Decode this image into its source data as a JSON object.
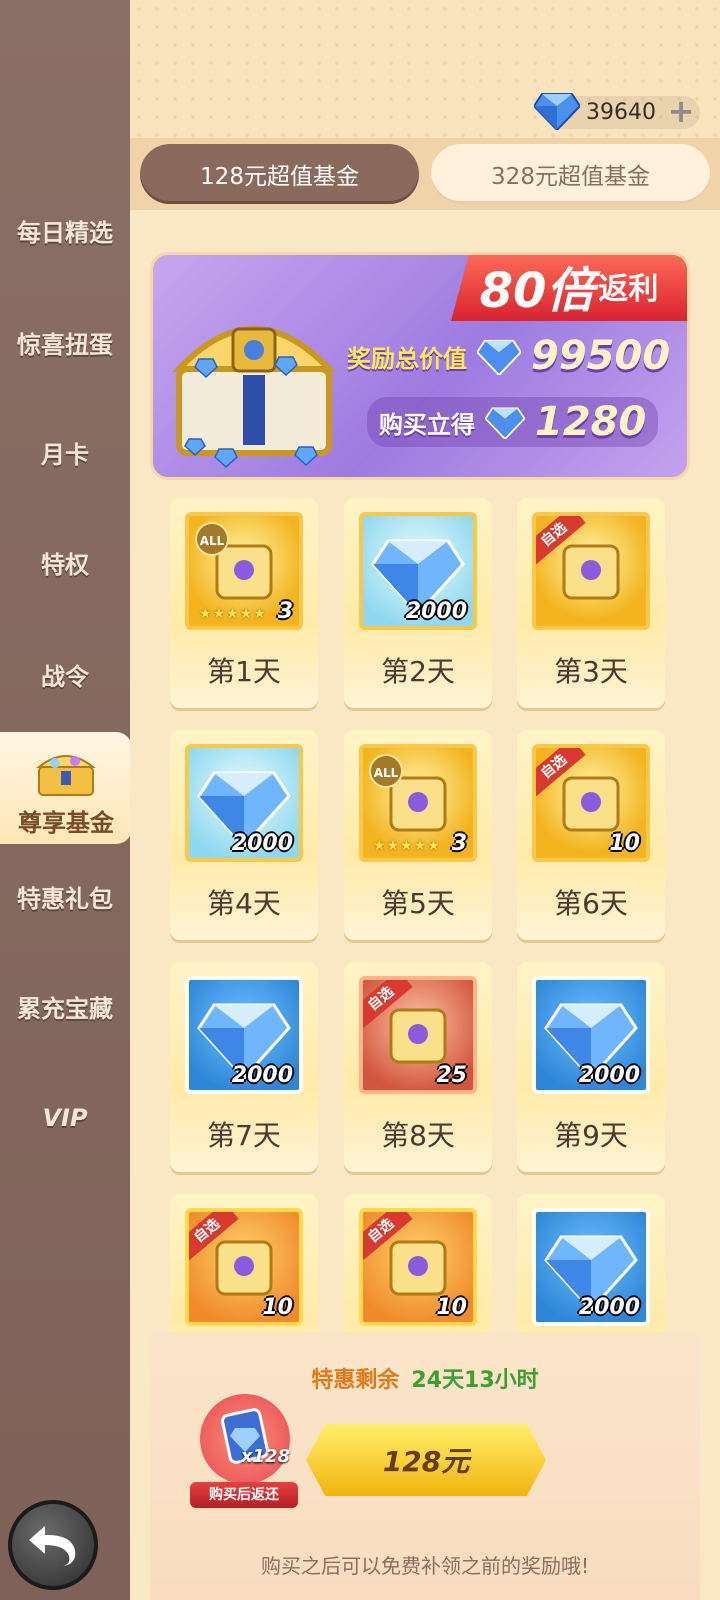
{
  "sidebar": {
    "items": [
      {
        "label": "每日精选"
      },
      {
        "label": "惊喜扭蛋"
      },
      {
        "label": "月卡"
      },
      {
        "label": "特权"
      },
      {
        "label": "战令"
      },
      {
        "label": "尊享基金"
      },
      {
        "label": "特惠礼包"
      },
      {
        "label": "累充宝藏"
      },
      {
        "label": "VIP"
      }
    ]
  },
  "currency": {
    "value": "39640",
    "icon": "diamond-icon",
    "plus": "+"
  },
  "tabs": [
    {
      "label": "128元超值基金",
      "active": true
    },
    {
      "label": "328元超值基金",
      "active": false
    }
  ],
  "banner": {
    "multiplier": "80倍",
    "rebate": "返利",
    "total_label": "奖励总价值",
    "total_value": "99500",
    "instant_label": "购买立得",
    "instant_value": "1280"
  },
  "rewards": [
    {
      "day": "第1天",
      "style": "gold",
      "qty": "3",
      "tag": "ALL",
      "stars": 5
    },
    {
      "day": "第2天",
      "style": "lightblue",
      "qty": "2000",
      "tag": "",
      "stars": 0
    },
    {
      "day": "第3天",
      "style": "gold",
      "qty": "",
      "tag": "自选",
      "stars": 0
    },
    {
      "day": "第4天",
      "style": "lightblue",
      "qty": "2000",
      "tag": "",
      "stars": 0
    },
    {
      "day": "第5天",
      "style": "gold",
      "qty": "3",
      "tag": "ALL",
      "stars": 5
    },
    {
      "day": "第6天",
      "style": "gold",
      "qty": "10",
      "tag": "自选",
      "stars": 0
    },
    {
      "day": "第7天",
      "style": "blue",
      "qty": "2000",
      "tag": "",
      "stars": 0
    },
    {
      "day": "第8天",
      "style": "red",
      "qty": "25",
      "tag": "自选",
      "stars": 0
    },
    {
      "day": "第9天",
      "style": "blue",
      "qty": "2000",
      "tag": "",
      "stars": 0
    },
    {
      "day": "",
      "style": "orange",
      "qty": "10",
      "tag": "自选",
      "stars": 0
    },
    {
      "day": "",
      "style": "orange",
      "qty": "10",
      "tag": "自选",
      "stars": 0
    },
    {
      "day": "",
      "style": "blue",
      "qty": "2000",
      "tag": "",
      "stars": 0
    }
  ],
  "countdown": {
    "label": "特惠剩余",
    "value": "24天13小时"
  },
  "refund": {
    "qty": "x128",
    "caption": "购买后返还"
  },
  "buy": {
    "label": "128元"
  },
  "footnote": "购买之后可以免费补领之前的奖励哦!"
}
